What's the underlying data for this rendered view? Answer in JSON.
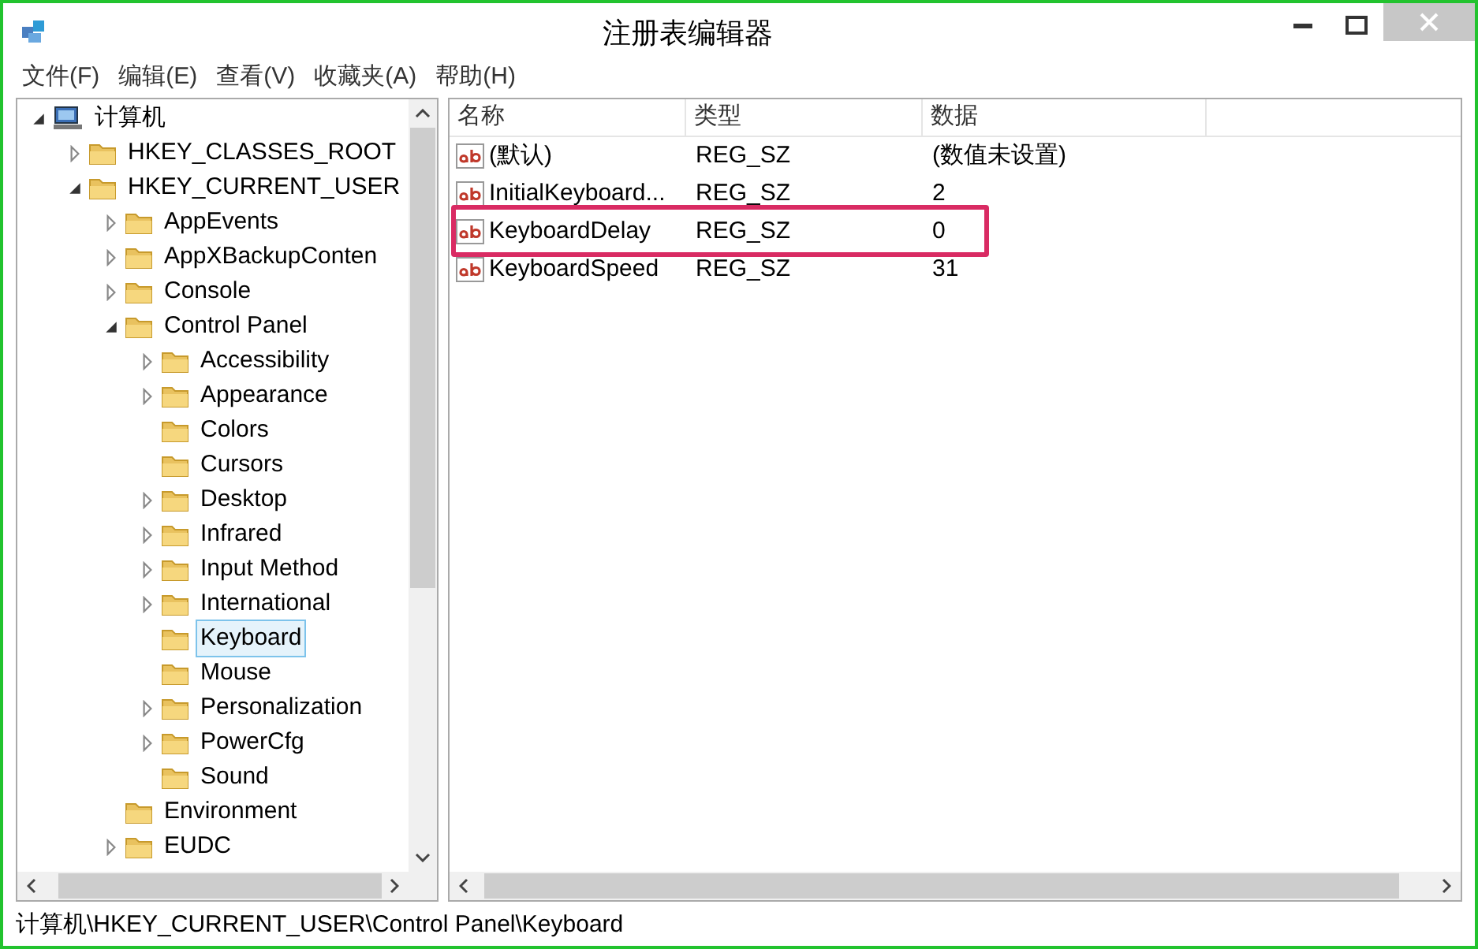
{
  "window": {
    "title": "注册表编辑器"
  },
  "menu": [
    {
      "label": "文件(F)"
    },
    {
      "label": "编辑(E)"
    },
    {
      "label": "查看(V)"
    },
    {
      "label": "收藏夹(A)"
    },
    {
      "label": "帮助(H)"
    }
  ],
  "tree": [
    {
      "label": "计算机",
      "kind": "computer",
      "expandable": true,
      "expanded": true,
      "selected": false,
      "children": [
        {
          "label": "HKEY_CLASSES_ROOT",
          "kind": "folder",
          "expandable": true,
          "expanded": false,
          "selected": false
        },
        {
          "label": "HKEY_CURRENT_USER",
          "kind": "folder",
          "expandable": true,
          "expanded": true,
          "selected": false,
          "children": [
            {
              "label": "AppEvents",
              "kind": "folder",
              "expandable": true,
              "expanded": false,
              "selected": false
            },
            {
              "label": "AppXBackupConten",
              "kind": "folder",
              "expandable": true,
              "expanded": false,
              "selected": false
            },
            {
              "label": "Console",
              "kind": "folder",
              "expandable": true,
              "expanded": false,
              "selected": false
            },
            {
              "label": "Control Panel",
              "kind": "folder",
              "expandable": true,
              "expanded": true,
              "selected": false,
              "children": [
                {
                  "label": "Accessibility",
                  "kind": "folder",
                  "expandable": true,
                  "expanded": false,
                  "selected": false
                },
                {
                  "label": "Appearance",
                  "kind": "folder",
                  "expandable": true,
                  "expanded": false,
                  "selected": false
                },
                {
                  "label": "Colors",
                  "kind": "folder",
                  "expandable": false,
                  "selected": false
                },
                {
                  "label": "Cursors",
                  "kind": "folder",
                  "expandable": false,
                  "selected": false
                },
                {
                  "label": "Desktop",
                  "kind": "folder",
                  "expandable": true,
                  "expanded": false,
                  "selected": false
                },
                {
                  "label": "Infrared",
                  "kind": "folder",
                  "expandable": true,
                  "expanded": false,
                  "selected": false
                },
                {
                  "label": "Input Method",
                  "kind": "folder",
                  "expandable": true,
                  "expanded": false,
                  "selected": false
                },
                {
                  "label": "International",
                  "kind": "folder",
                  "expandable": true,
                  "expanded": false,
                  "selected": false
                },
                {
                  "label": "Keyboard",
                  "kind": "folder",
                  "expandable": false,
                  "selected": true
                },
                {
                  "label": "Mouse",
                  "kind": "folder",
                  "expandable": false,
                  "selected": false
                },
                {
                  "label": "Personalization",
                  "kind": "folder",
                  "expandable": true,
                  "expanded": false,
                  "selected": false
                },
                {
                  "label": "PowerCfg",
                  "kind": "folder",
                  "expandable": true,
                  "expanded": false,
                  "selected": false
                },
                {
                  "label": "Sound",
                  "kind": "folder",
                  "expandable": false,
                  "selected": false
                }
              ]
            },
            {
              "label": "Environment",
              "kind": "folder",
              "expandable": false,
              "selected": false
            },
            {
              "label": "EUDC",
              "kind": "folder",
              "expandable": true,
              "expanded": false,
              "selected": false
            }
          ]
        }
      ]
    }
  ],
  "table": {
    "columns": [
      "名称",
      "类型",
      "数据"
    ],
    "rows": [
      {
        "name": "(默认)",
        "type": "REG_SZ",
        "data": "(数值未设置)",
        "highlighted": false
      },
      {
        "name": "InitialKeyboard...",
        "type": "REG_SZ",
        "data": "2",
        "highlighted": false
      },
      {
        "name": "KeyboardDelay",
        "type": "REG_SZ",
        "data": "0",
        "highlighted": true
      },
      {
        "name": "KeyboardSpeed",
        "type": "REG_SZ",
        "data": "31",
        "highlighted": false
      }
    ]
  },
  "status_bar": "计算机\\HKEY_CURRENT_USER\\Control Panel\\Keyboard"
}
